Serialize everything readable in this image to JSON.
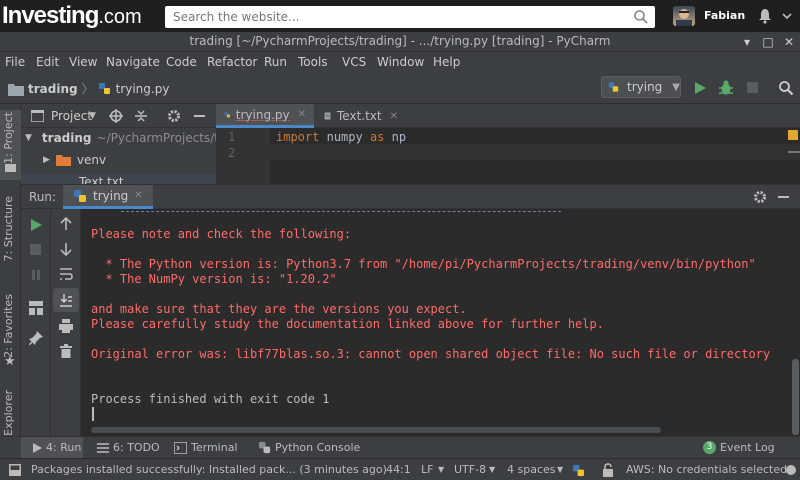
{
  "site": {
    "logo_main": "Investing",
    "logo_suffix": ".com",
    "search_placeholder": "Search the website...",
    "username": "Fabian"
  },
  "window": {
    "title": "trading [~/PycharmProjects/trading] - .../trying.py [trading] - PyCharm"
  },
  "menu": [
    "File",
    "Edit",
    "View",
    "Navigate",
    "Code",
    "Refactor",
    "Run",
    "Tools",
    "VCS",
    "Window",
    "Help"
  ],
  "breadcrumb": {
    "project": "trading",
    "file": "trying.py"
  },
  "run_config": {
    "label": "trying"
  },
  "left_strip": {
    "project": "1: Project",
    "structure": "7: Structure",
    "favorites": "2: Favorites",
    "explorer": "Explorer"
  },
  "project_panel": {
    "title": "Project",
    "root_name": "trading",
    "root_path": "~/PycharmProjects/t",
    "items": [
      "venv",
      "Text.txt"
    ]
  },
  "editor": {
    "tabs": [
      "trying.py",
      "Text.txt"
    ],
    "line_numbers": [
      "1",
      "2"
    ],
    "line1_kw1": "import",
    "line1_mod": "numpy",
    "line1_kw2": "as",
    "line1_alias": "np"
  },
  "run_panel": {
    "label": "Run:",
    "tab": "trying",
    "lines": [
      "Please note and check the following:",
      "  * The Python version is: Python3.7 from \"/home/pi/PycharmProjects/trading/venv/bin/python\"",
      "  * The NumPy version is: \"1.20.2\"",
      "and make sure that they are the versions you expect.",
      "Please carefully study the documentation linked above for further help.",
      "Original error was: libf77blas.so.3: cannot open shared object file: No such file or directory",
      "Process finished with exit code 1"
    ]
  },
  "bottom_tools": {
    "run": "4: Run",
    "todo": "6: TODO",
    "terminal": "Terminal",
    "python_console": "Python Console",
    "event_log_count": "3",
    "event_log": "Event Log"
  },
  "status": {
    "message": "Packages installed successfully: Installed pack... (3 minutes ago)",
    "position": "44:1",
    "line_sep": "LF",
    "encoding": "UTF-8",
    "indent": "4 spaces",
    "aws": "AWS: No credentials selected"
  },
  "colors": {
    "accent_blue": "#4a88c7",
    "error_red": "#ff6b68",
    "run_green": "#59a869",
    "folder_orange": "#e07b39"
  }
}
